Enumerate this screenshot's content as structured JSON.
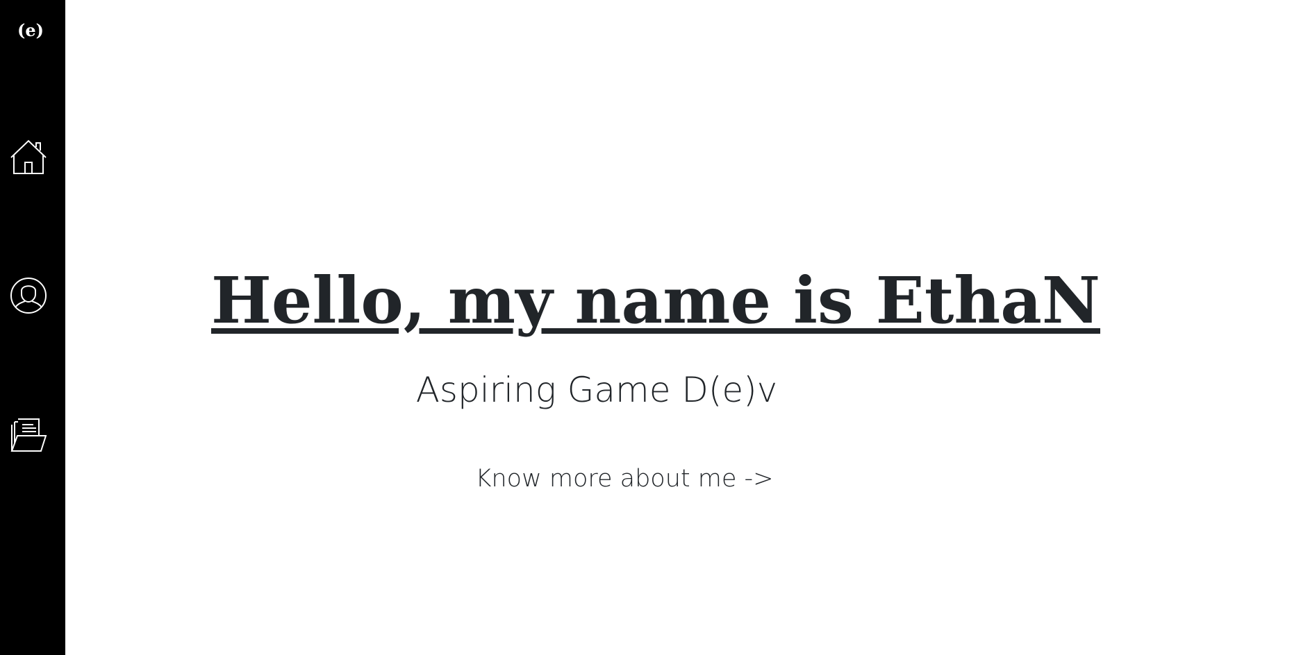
{
  "sidebar": {
    "logo": "(e)",
    "nav": [
      {
        "icon": "home-icon"
      },
      {
        "icon": "user-profile-icon"
      },
      {
        "icon": "folder-documents-icon"
      }
    ]
  },
  "main": {
    "title": "Hello, my name is EthaN",
    "subtitle": "Aspiring Game D(e)v",
    "cta_label": "Know more about me ->"
  },
  "colors": {
    "sidebar_bg": "#000000",
    "text": "#212529",
    "background": "#ffffff"
  }
}
